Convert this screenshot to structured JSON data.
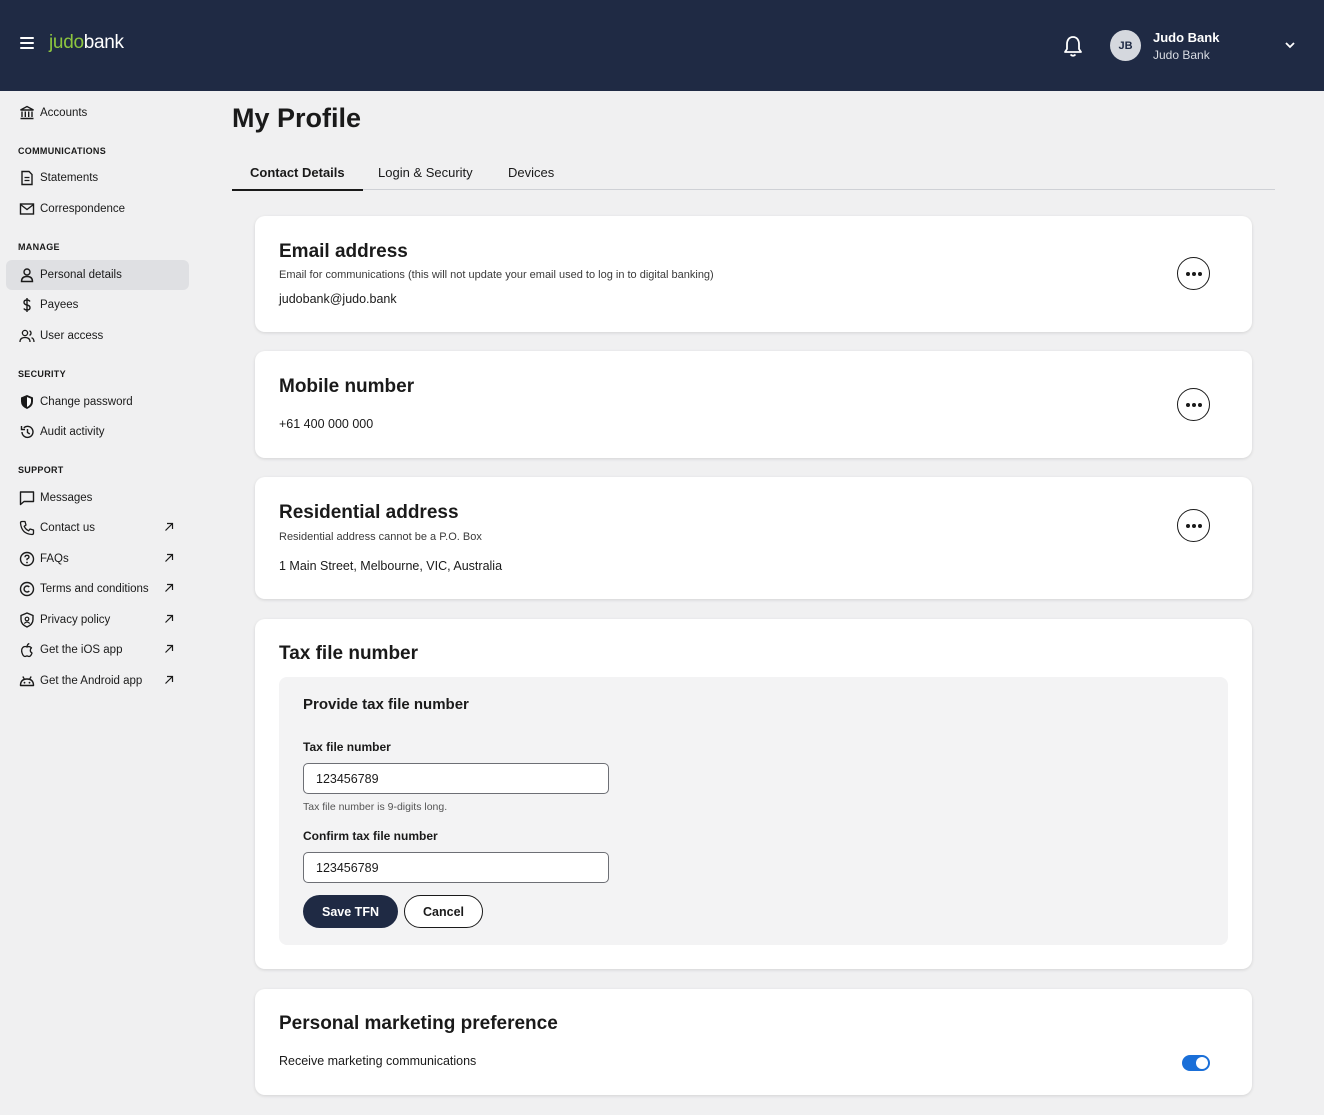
{
  "header": {
    "logo_part1": "judo",
    "logo_part2": "bank",
    "avatar_initials": "JB",
    "user_name": "Judo Bank",
    "user_org": "Judo Bank"
  },
  "sidebar": {
    "accounts": "Accounts",
    "communications_heading": "COMMUNICATIONS",
    "statements": "Statements",
    "correspondence": "Correspondence",
    "manage_heading": "MANAGE",
    "personal_details": "Personal details",
    "payees": "Payees",
    "user_access": "User access",
    "security_heading": "SECURITY",
    "change_password": "Change password",
    "audit_activity": "Audit activity",
    "support_heading": "SUPPORT",
    "messages": "Messages",
    "contact_us": "Contact us",
    "faqs": "FAQs",
    "terms": "Terms and conditions",
    "privacy": "Privacy policy",
    "ios_app": "Get the iOS app",
    "android_app": "Get the Android app"
  },
  "page": {
    "title": "My Profile",
    "tabs": [
      "Contact Details",
      "Login & Security",
      "Devices"
    ]
  },
  "email": {
    "title": "Email address",
    "subtitle": "Email for communications (this will not update your email used to log in to digital banking)",
    "value": "judobank@judo.bank"
  },
  "mobile": {
    "title": "Mobile number",
    "value": "+61 400 000 000"
  },
  "address": {
    "title": "Residential address",
    "subtitle": "Residential address cannot be a P.O. Box",
    "value": "1 Main Street, Melbourne, VIC, Australia"
  },
  "tfn": {
    "title": "Tax file number",
    "panel_title": "Provide tax file number",
    "tfn_label": "Tax file number",
    "tfn_value": "123456789",
    "tfn_help": "Tax file number is 9-digits long.",
    "confirm_label": "Confirm tax file number",
    "confirm_value": "123456789",
    "save_label": "Save TFN",
    "cancel_label": "Cancel"
  },
  "marketing": {
    "title": "Personal marketing preference",
    "label": "Receive marketing communications",
    "enabled": true
  },
  "colors": {
    "header_bg": "#1f2a44",
    "logo_accent": "#8dc63f",
    "toggle_on": "#1a6fd8"
  }
}
